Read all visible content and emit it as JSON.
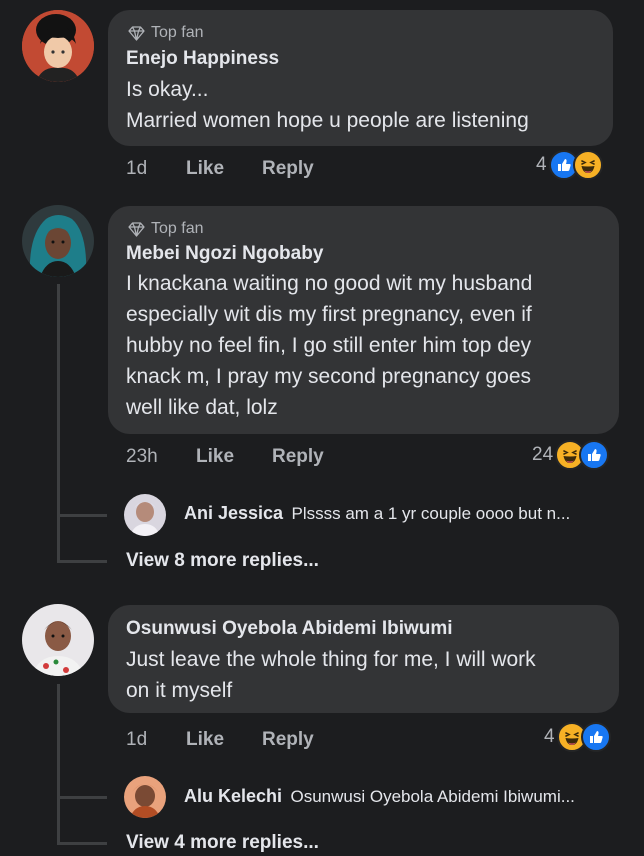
{
  "comments": [
    {
      "badge": "Top fan",
      "author": "Enejo Happiness",
      "lines": [
        "Is okay...",
        "Married women hope u people are listening"
      ],
      "time": "1d",
      "like_label": "Like",
      "reply_label": "Reply",
      "reaction_count": "4",
      "reactions": [
        "like-icon",
        "haha-icon"
      ]
    },
    {
      "badge": "Top fan",
      "author": "Mebei Ngozi Ngobaby",
      "lines": [
        "I knackana waiting no good wit my husband",
        "especially wit dis my first pregnancy, even if",
        "hubby no feel fin, I go still enter him top dey",
        "knack m, I pray my second pregnancy goes",
        "well like dat, lolz"
      ],
      "time": "23h",
      "like_label": "Like",
      "reply_label": "Reply",
      "reaction_count": "24",
      "reactions": [
        "haha-icon",
        "like-icon"
      ],
      "reply_preview": {
        "author": "Ani Jessica",
        "text": "Plssss am a 1 yr couple oooo but n..."
      },
      "view_more": "View 8 more replies..."
    },
    {
      "author": "Osunwusi Oyebola Abidemi Ibiwumi",
      "lines": [
        "Just leave the whole thing for me, I will work",
        "on it myself"
      ],
      "time": "1d",
      "like_label": "Like",
      "reply_label": "Reply",
      "reaction_count": "4",
      "reactions": [
        "haha-icon",
        "like-icon"
      ],
      "reply_preview": {
        "author": "Alu Kelechi",
        "text": "Osunwusi Oyebola Abidemi Ibiwumi..."
      },
      "view_more": "View 4 more replies..."
    }
  ],
  "colors": {
    "background": "#1c1d1f",
    "bubble": "#333436",
    "text": "#e4e6eb",
    "muted": "#b0b3b8",
    "like_blue": "#1877f2",
    "haha_yellow": "#f7b125"
  }
}
